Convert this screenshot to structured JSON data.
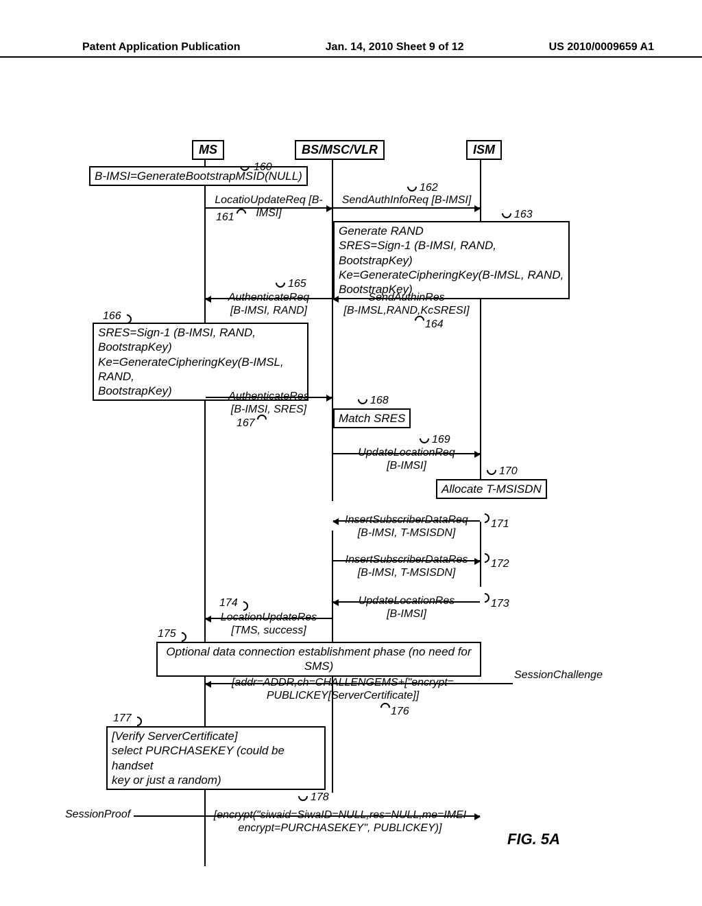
{
  "header": {
    "left": "Patent Application Publication",
    "center": "Jan. 14, 2010  Sheet 9 of 12",
    "right": "US 2010/0009659 A1"
  },
  "participants": {
    "ms": "MS",
    "bs": "BS/MSC/VLR",
    "ism": "ISM"
  },
  "boxes": {
    "b160": "B-IMSI=GenerateBootstrapMSID(NULL)",
    "b163_l1": "Generate RAND",
    "b163_l2": "SRES=Sign-1 (B-IMSI, RAND, BootstrapKey)",
    "b163_l3": "Ke=GenerateCipheringKey(B-IMSL, RAND,",
    "b163_l4": "BootstrapKey)",
    "b166_l1": "SRES=Sign-1 (B-IMSI, RAND, BootstrapKey)",
    "b166_l2": "Ke=GenerateCipheringKey(B-IMSL, RAND,",
    "b166_l3": "BootstrapKey)",
    "b168": "Match SRES",
    "b170": "Allocate T-MSISDN",
    "b175": "Optional data connection establishment phase (no need for SMS)",
    "b177_l1": "[Verify ServerCertificate]",
    "b177_l2": "select PURCHASEKEY (could be handset",
    "b177_l3": "key or just a random)"
  },
  "msgs": {
    "m161_l1": "LocatioUpdateReq [B-IMSI]",
    "m162_l1": "SendAuthInfoReq [B-IMSI]",
    "m164_l1": "SendAuthinRes",
    "m164_l2": "[B-IMSL,RAND,KcSRESI]",
    "m165_l1": "AuthenticateReq",
    "m165_l2": "[B-IMSI, RAND]",
    "m167_l1": "AuthenticateRes",
    "m167_l2": "[B-IMSI, SRES]",
    "m169_l1": "UpdateLocationReq",
    "m169_l2": "[B-IMSI]",
    "m171_l1": "InsertSubscriberDataReq",
    "m171_l2": "[B-IMSI, T-MSISDN]",
    "m172_l1": "InsertSubscriberDataRes",
    "m172_l2": "[B-IMSI, T-MSISDN]",
    "m173_l1": "UpdateLocationRes",
    "m173_l2": "[B-IMSI]",
    "m174_l1": "LocationUpdateRes",
    "m174_l2": "[TMS, success]",
    "m176_l1": "[addr=ADDR,ch=CHALLENGEMS+[\"encrypt=",
    "m176_l2": "PUBLICKEY[ServerCertificate]]",
    "m176_sc": "SessionChallenge",
    "m178_l1": "[encrypt(\"siwaid=SiwaID=NULL,res=NULL,me=IMEI",
    "m178_l2": "encrypt=PURCHASEKEY\", PUBLICKEY)]",
    "m178_sp": "SessionProof"
  },
  "refs": {
    "r160": "160",
    "r161": "161",
    "r162": "162",
    "r163": "163",
    "r164": "164",
    "r165": "165",
    "r166": "166",
    "r167": "167",
    "r168": "168",
    "r169": "169",
    "r170": "170",
    "r171": "171",
    "r172": "172",
    "r173": "173",
    "r174": "174",
    "r175": "175",
    "r176": "176",
    "r177": "177",
    "r178": "178"
  },
  "figure": "FIG. 5A"
}
